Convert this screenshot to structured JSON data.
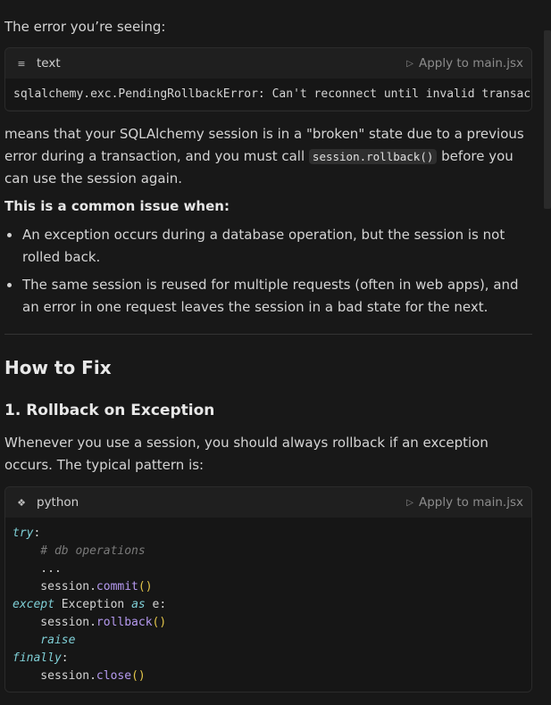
{
  "intro": "The error you’re seeing:",
  "code1": {
    "lang": "text",
    "icon": "lines-icon",
    "apply": "Apply to main.jsx",
    "code": "sqlalchemy.exc.PendingRollbackError: Can't reconnect until invalid transaction is rolled back"
  },
  "after1": {
    "part1": "means that your SQLAlchemy session is in a \"broken\" state due to a previous error during a transaction, and you must call ",
    "inline": "session.rollback()",
    "part2": " before you can use the session again."
  },
  "common": "This is a common issue when:",
  "bullets": [
    "An exception occurs during a database operation, but the session is not rolled back.",
    "The same session is reused for multiple requests (often in web apps), and an error in one request leaves the session in a bad state for the next."
  ],
  "how_to_fix": "How to Fix",
  "section1": "1. Rollback on Exception",
  "para2": "Whenever you use a session, you should always rollback if an exception occurs. The typical pattern is:",
  "code2": {
    "lang": "python",
    "icon": "python-icon",
    "apply": "Apply to main.jsx",
    "lines": {
      "l1_kw": "try",
      "l1_p": ":",
      "l2": "    # db operations",
      "l3": "    ...",
      "l4_a": "    session.",
      "l4_fn": "commit",
      "l4_p": "()",
      "l5_kw": "except",
      "l5_a": " Exception ",
      "l5_kw2": "as",
      "l5_b": " e:",
      "l6_a": "    session.",
      "l6_fn": "rollback",
      "l6_p": "()",
      "l7_kw": "    raise",
      "l8_kw": "finally",
      "l8_p": ":",
      "l9_a": "    session.",
      "l9_fn": "close",
      "l9_p": "()"
    }
  }
}
